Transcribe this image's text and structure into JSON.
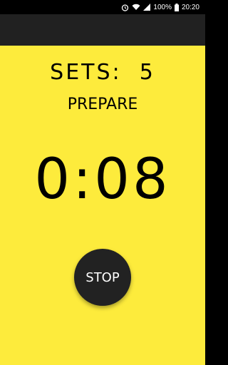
{
  "status_bar": {
    "battery_text": "100%",
    "time": "20:20",
    "icons": [
      "alarm-icon",
      "wifi-icon",
      "signal-icon",
      "battery-icon"
    ]
  },
  "workout": {
    "sets_label": "SETS:",
    "sets_value": "5",
    "phase": "PREPARE",
    "timer": "0:08",
    "stop_label": "STOP"
  },
  "colors": {
    "background": "#FDEB3C",
    "app_bar": "#212121",
    "stop_button": "#222222"
  }
}
